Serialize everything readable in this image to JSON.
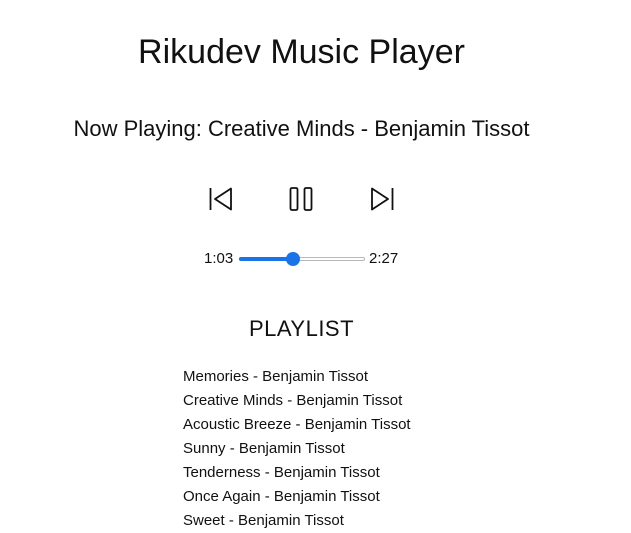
{
  "app": {
    "title": "Rikudev Music Player"
  },
  "now_playing": {
    "text": "Now Playing: Creative Minds - Benjamin Tissot"
  },
  "controls": {
    "prev_icon": "skip-previous-icon",
    "pause_icon": "pause-icon",
    "next_icon": "skip-next-icon"
  },
  "progress": {
    "current_time": "1:03",
    "total_time": "2:27",
    "fraction": 0.43,
    "accent_color": "#1a73e8"
  },
  "playlist": {
    "heading": "PLAYLIST",
    "items": [
      "Memories - Benjamin Tissot",
      "Creative Minds - Benjamin Tissot",
      "Acoustic Breeze - Benjamin Tissot",
      "Sunny - Benjamin Tissot",
      "Tenderness - Benjamin Tissot",
      "Once Again - Benjamin Tissot",
      "Sweet - Benjamin Tissot"
    ]
  }
}
